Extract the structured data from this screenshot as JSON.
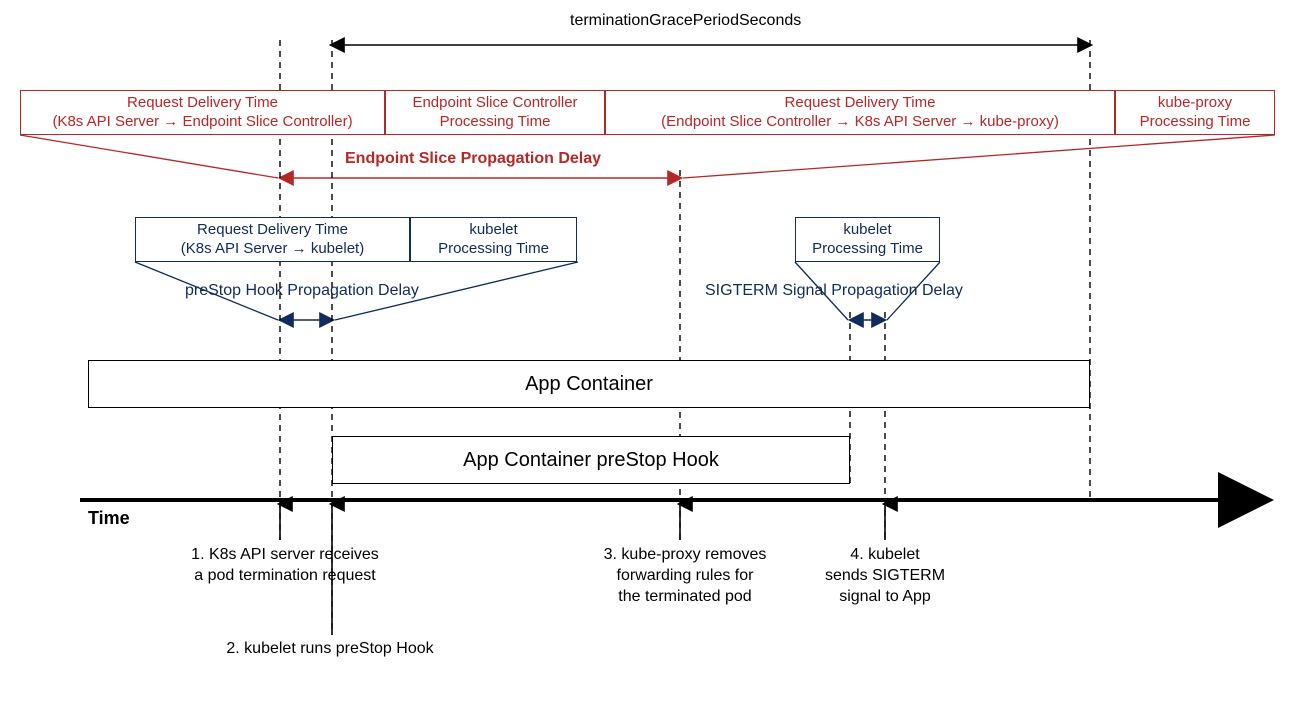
{
  "top_label": "terminationGracePeriodSeconds",
  "red_boxes": {
    "a": {
      "l1": "Request Delivery Time",
      "l2": "(K8s API Server → Endpoint Slice Controller)"
    },
    "b": {
      "l1": "Endpoint Slice Controller",
      "l2": "Processing Time"
    },
    "c": {
      "l1": "Request Delivery Time",
      "l2": "(Endpoint Slice Controller → K8s API Server → kube-proxy)"
    },
    "d": {
      "l1": "kube-proxy",
      "l2": "Processing Time"
    }
  },
  "red_delay_label": "Endpoint Slice Propagation Delay",
  "blue_boxes": {
    "a": {
      "l1": "Request Delivery Time",
      "l2": "(K8s API Server → kubelet)"
    },
    "b": {
      "l1": "kubelet",
      "l2": "Processing Time"
    },
    "c": {
      "l1": "kubelet",
      "l2": "Processing Time"
    }
  },
  "blue_delay1": "preStop Hook Propagation Delay",
  "blue_delay2": "SIGTERM Signal Propagation Delay",
  "app_container": "App Container",
  "prestop_hook": "App Container preStop Hook",
  "time_label": "Time",
  "events": {
    "e1": {
      "l1": "1. K8s API server receives",
      "l2": "a pod termination request"
    },
    "e2": "2. kubelet runs preStop Hook",
    "e3": {
      "l1": "3. kube-proxy removes",
      "l2": "forwarding rules for",
      "l3": "the terminated pod"
    },
    "e4": {
      "l1": "4. kubelet",
      "l2": "sends SIGTERM",
      "l3": "signal to App"
    }
  }
}
